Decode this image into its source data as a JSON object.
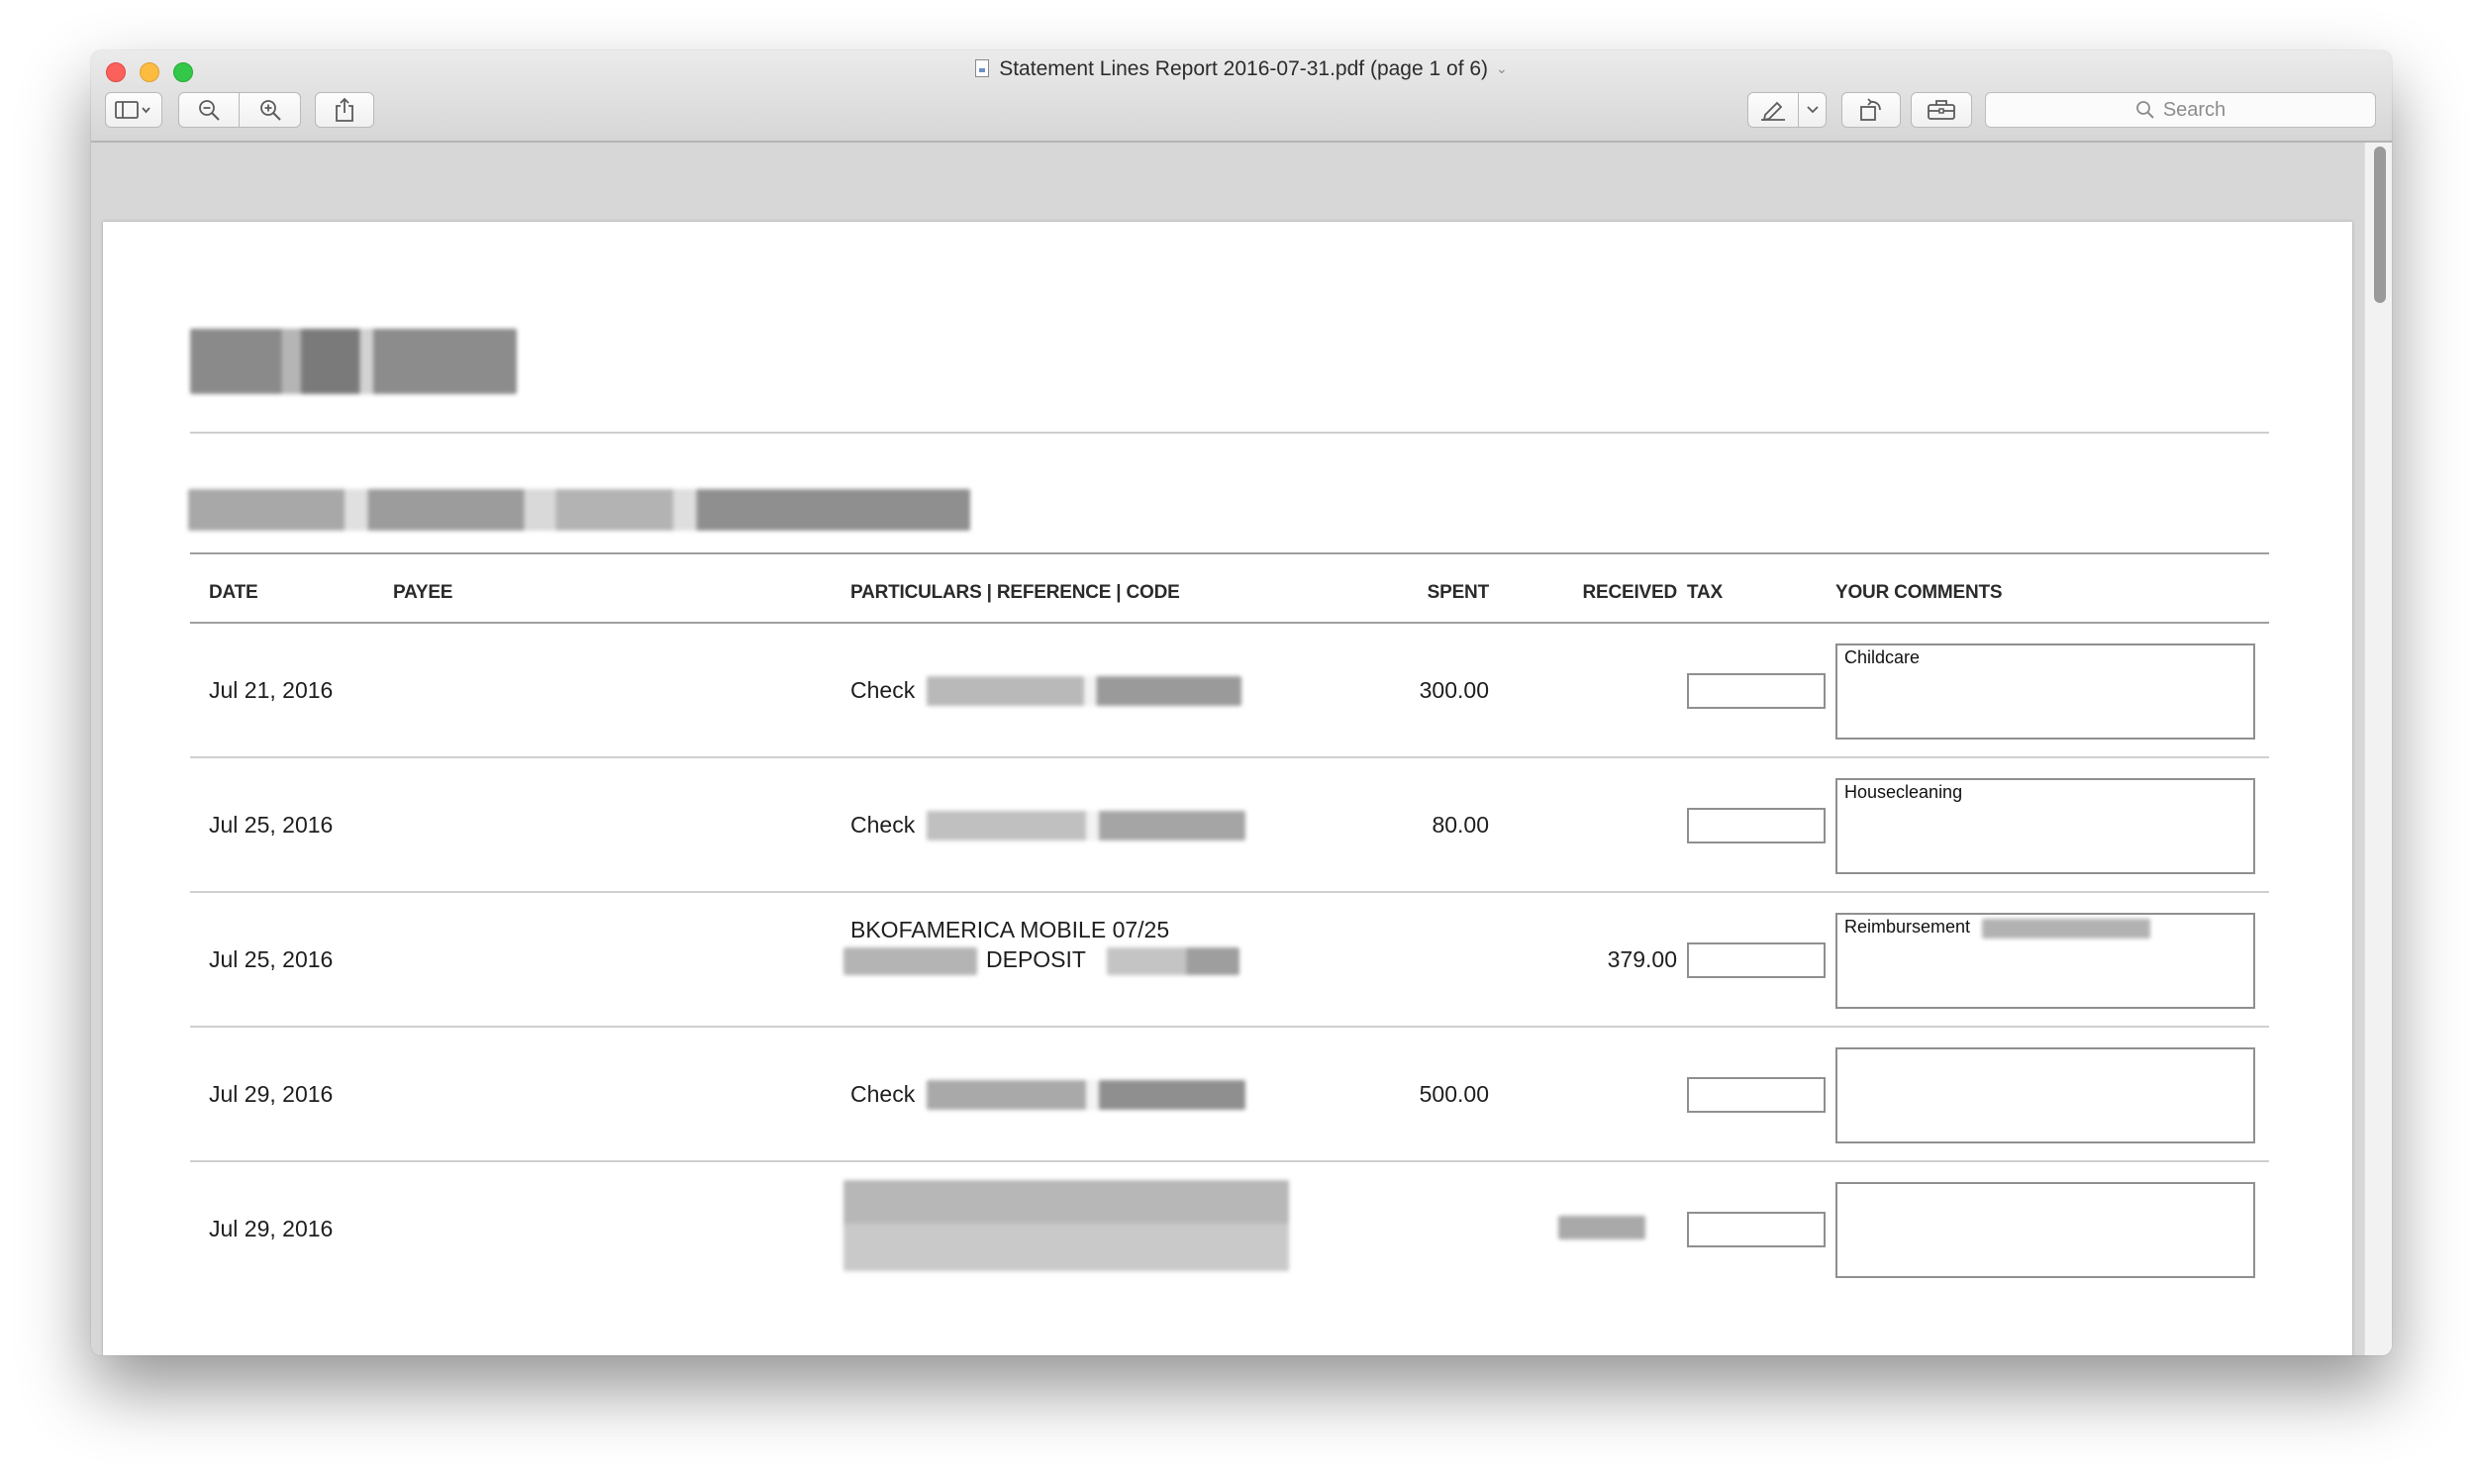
{
  "window": {
    "title": "Statement Lines Report 2016-07-31.pdf (page 1 of 6)"
  },
  "toolbar": {
    "sidebar_icon": "sidebar-icon",
    "zoom_out_icon": "zoom-out-icon",
    "zoom_in_icon": "zoom-in-icon",
    "share_icon": "share-icon",
    "markup_icon": "pen-icon",
    "rotate_icon": "rotate-icon",
    "toolbox_icon": "toolbox-icon",
    "search_placeholder": "Search"
  },
  "table": {
    "headers": {
      "date": "DATE",
      "payee": "PAYEE",
      "particulars": "PARTICULARS | REFERENCE | CODE",
      "spent": "SPENT",
      "received": "RECEIVED",
      "tax": "TAX",
      "comments": "YOUR COMMENTS"
    },
    "rows": [
      {
        "date": "Jul 21, 2016",
        "particulars": "Check",
        "spent": "300.00",
        "received": "",
        "comment": "Childcare"
      },
      {
        "date": "Jul 25, 2016",
        "particulars": "Check",
        "spent": "80.00",
        "received": "",
        "comment": "Housecleaning"
      },
      {
        "date": "Jul 25, 2016",
        "particulars": "BKOFAMERICA MOBILE 07/25",
        "particulars_line2": "DEPOSIT",
        "spent": "",
        "received": "379.00",
        "comment": "Reimbursement"
      },
      {
        "date": "Jul 29, 2016",
        "particulars": "Check",
        "spent": "500.00",
        "received": "",
        "comment": ""
      },
      {
        "date": "Jul 29, 2016",
        "particulars": "",
        "spent": "",
        "received": "",
        "comment": ""
      }
    ]
  },
  "colors": {
    "close": "#fc605b",
    "minimize": "#fdbc40",
    "zoom": "#34c84a"
  }
}
